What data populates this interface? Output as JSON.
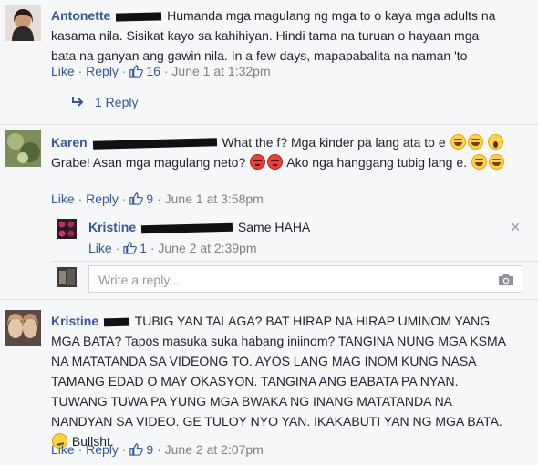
{
  "comments": [
    {
      "author": "Antonette",
      "text": "Humanda mga magulang ng mga to o kaya mga adults na kasama nila. Sisikat kayo sa kahihiyan. Hindi tama na turuan o hayaan mga bata na ganyan ang gawin nila. In a few days, mapapabalita na naman 'to",
      "like": "Like",
      "reply": "Reply",
      "likes": "16",
      "time": "June 1 at 1:32pm",
      "replies_link": "1 Reply"
    },
    {
      "author": "Karen",
      "text_a": "What the f? Mga kinder pa lang ata to e",
      "text_b": "Grabe! Asan mga magulang neto?",
      "text_c": "Ako nga hanggang tubig lang e.",
      "like": "Like",
      "reply": "Reply",
      "likes": "9",
      "time": "June 1 at 3:58pm",
      "emoji": [
        "laugh",
        "laugh",
        "scream",
        "angry",
        "angry",
        "laugh",
        "laugh"
      ],
      "reply_item": {
        "author": "Kristine",
        "text": "Same HAHA",
        "like": "Like",
        "likes": "1",
        "time": "June 2 at 2:39pm",
        "close": "×"
      },
      "reply_box": {
        "placeholder": "Write a reply..."
      }
    },
    {
      "author": "Kristine",
      "text": "TUBIG YAN TALAGA? BAT HIRAP NA HIRAP UMINOM YANG MGA BATA? Tapos masuka suka habang iniinom? TANGINA NUNG MGA KSMA NA MATATANDA SA VIDEONG TO. AYOS LANG MAG INOM KUNG NASA TAMANG EDAD O MAY OKASYON. TANGINA ANG BABATA PA NYAN. TUWANG TUWA PA YUNG MGA BWAKA NG INANG MATATANDA NA NANDYAN SA VIDEO. GE TULOY NYO YAN. IKAKABUTI YAN NG MGA BATA.",
      "text_end": "Bullsht.",
      "emoji": [
        "smirk"
      ],
      "like": "Like",
      "reply": "Reply",
      "likes": "9",
      "time": "June 2 at 2:07pm"
    }
  ],
  "separator": "·",
  "colors": {
    "link": "#365899",
    "meta": "#7f7f7f",
    "background": "#f6f7f9"
  }
}
